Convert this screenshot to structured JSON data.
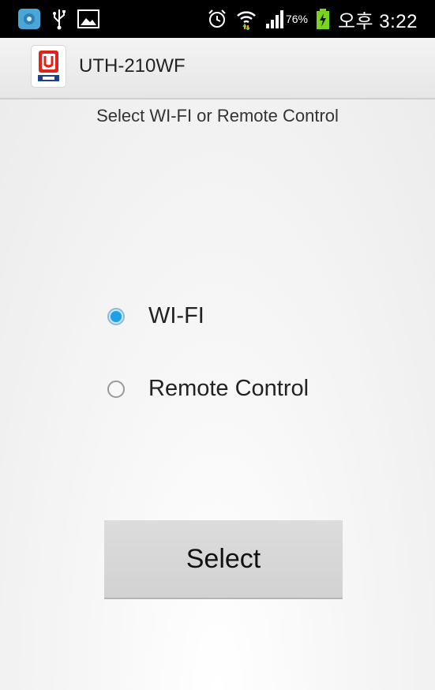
{
  "status_bar": {
    "battery_percent": "76%",
    "time": "오후 3:22",
    "icons": [
      "media-app-icon",
      "usb-icon",
      "gallery-icon",
      "alarm-icon",
      "wifi-icon",
      "signal-icon",
      "battery-charging-icon"
    ]
  },
  "action_bar": {
    "title": "UTH-210WF",
    "logo_icon": "app-logo-icon"
  },
  "main": {
    "subtitle": "Select WI-FI or Remote Control",
    "options": [
      {
        "label": "WI-FI",
        "checked": true
      },
      {
        "label": "Remote Control",
        "checked": false
      }
    ],
    "select_label": "Select"
  },
  "colors": {
    "radio_accent": "#1ea0e6",
    "status_bar_bg": "#000000",
    "battery_icon": "#7ad321"
  }
}
